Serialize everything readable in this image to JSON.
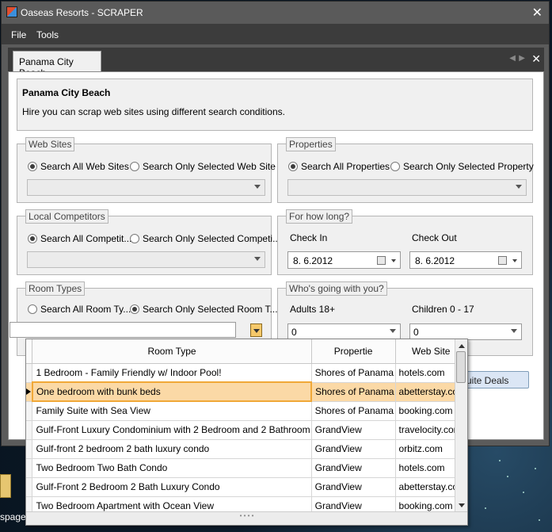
{
  "window": {
    "title": "Oaseas Resorts - SCRAPER"
  },
  "menu": [
    "File",
    "Tools"
  ],
  "tab": {
    "label": "Panama City Beach"
  },
  "header": {
    "title": "Panama City Beach",
    "subtitle": "Hire you can scrap web sites using different search conditions."
  },
  "web_sites": {
    "legend": "Web Sites",
    "option_all": "Search All Web Sites",
    "option_selected": "Search Only Selected Web Site"
  },
  "properties": {
    "legend": "Properties",
    "option_all": "Search All Properties",
    "option_selected": "Search Only Selected Property"
  },
  "competitors": {
    "legend": "Local Competitors",
    "option_all": "Search All Competit...",
    "option_selected": "Search Only Selected Competi..."
  },
  "how_long": {
    "legend": "For how long?",
    "check_in_label": "Check In",
    "check_in_value": "8.  6.2012",
    "check_out_label": "Check Out",
    "check_out_value": "8.  6.2012"
  },
  "room_types": {
    "legend": "Room Types",
    "option_all": "Search All Room Ty...",
    "option_selected": "Search Only Selected Room T..."
  },
  "guests": {
    "legend": "Who's going with you?",
    "adults_label": "Adults 18+",
    "adults_value": "0",
    "children_label": "Children 0 - 17",
    "children_value": "0"
  },
  "deals_button": "uite Deals",
  "grid": {
    "columns": [
      "Room Type",
      "Propertie",
      "Web Site"
    ],
    "rows": [
      {
        "room": "1 Bedroom - Family Friendly w/ Indoor Pool!",
        "property": "Shores of Panama",
        "site": "hotels.com"
      },
      {
        "room": "One bedroom with bunk beds",
        "property": "Shores of Panama",
        "site": "abetterstay.com"
      },
      {
        "room": "Family Suite with Sea View",
        "property": "Shores of Panama",
        "site": "booking.com"
      },
      {
        "room": "Gulf-Front Luxury Condominium with 2 Bedroom and 2 Bathroom",
        "property": "GrandView",
        "site": "travelocity.com"
      },
      {
        "room": "Gulf-front 2 bedroom 2 bath luxury condo",
        "property": "GrandView",
        "site": "orbitz.com"
      },
      {
        "room": "Two Bedroom Two Bath Condo",
        "property": "GrandView",
        "site": "hotels.com"
      },
      {
        "room": "Gulf-Front 2 Bedroom 2 Bath Luxury Condo",
        "property": "GrandView",
        "site": "abetterstay.com"
      },
      {
        "room": "Two Bedroom Apartment with Ocean View",
        "property": "GrandView",
        "site": "booking.com"
      }
    ]
  },
  "desktop": {
    "label": "spage"
  }
}
